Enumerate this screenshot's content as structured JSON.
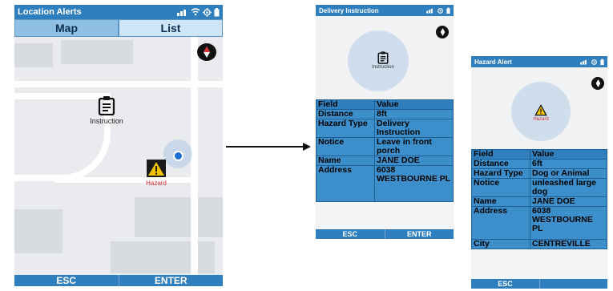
{
  "screens": {
    "location_alerts": {
      "title": "Location Alerts",
      "tabs": [
        {
          "label": "Map"
        },
        {
          "label": "List"
        }
      ],
      "markers": {
        "instruction": "Instruction",
        "hazard": "Hazard"
      },
      "softkeys": {
        "esc": "ESC",
        "enter": "ENTER"
      }
    },
    "delivery_instruction": {
      "title": "Delivery Instruction",
      "marker_label": "Instruction",
      "header": {
        "field": "Field",
        "value": "Value"
      },
      "rows": [
        {
          "field": "Distance",
          "value": "8ft"
        },
        {
          "field": "Hazard Type",
          "value": "Delivery Instruction"
        },
        {
          "field": "Notice",
          "value": "Leave in front porch"
        },
        {
          "field": "Name",
          "value": "JANE DOE"
        },
        {
          "field": "Address",
          "value": "6038 WESTBOURNE PL"
        }
      ],
      "softkeys": {
        "esc": "ESC",
        "enter": "ENTER"
      }
    },
    "hazard_alert": {
      "title": "Hazard Alert",
      "marker_label": "Hazard",
      "header": {
        "field": "Field",
        "value": "Value"
      },
      "rows": [
        {
          "field": "Distance",
          "value": "6ft"
        },
        {
          "field": "Hazard Type",
          "value": "Dog or Animal"
        },
        {
          "field": "Notice",
          "value": "unleashed large dog"
        },
        {
          "field": "Name",
          "value": "JANE DOE"
        },
        {
          "field": "Address",
          "value": "6038 WESTBOURNE PL"
        },
        {
          "field": "City",
          "value": "CENTREVILLE"
        }
      ],
      "softkeys": {
        "esc": "ESC"
      }
    }
  },
  "colors": {
    "accent": "#2f7fbe",
    "table_bg": "#3d8fcb",
    "hazard_label": "#d03030",
    "location_dot": "#1e6fd0"
  }
}
